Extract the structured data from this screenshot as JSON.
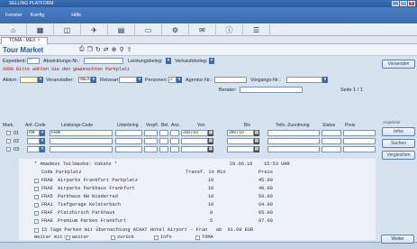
{
  "window": {
    "title": "SELLING PLATFORM"
  },
  "menu": [
    "Fenster",
    "Konfig",
    "Hilfe"
  ],
  "tab": {
    "label": "TOMA - MEX"
  },
  "page": {
    "title": "Tour Market"
  },
  "header": {
    "expedient_label": "Expedient:",
    "expedient_value": "**",
    "abwicklungs_label": "Abwicklungs-Nr.:",
    "leistungsbeleg_label": "Leistungsbeleg:",
    "verkaufsbeleg_label": "Verkaufsbeleg:",
    "error_msg": "X998 Bitte wählen Sie den gewünschten Parkplatz",
    "aktion_label": "Aktion:",
    "veranstalter_label": "Veranstalter:",
    "veranstalter_value": "MEX",
    "reiseart_label": "Reiseart:",
    "personen_label": "Personen:",
    "personen_value": "2",
    "agentur_label": "Agentur-Nr.:",
    "vorgangs_label": "Vorgangs-Nr.:",
    "berater_label": "Berater:",
    "seite_label": "Seite 1 / 1"
  },
  "grid": {
    "columns": [
      "Mark.",
      "Anf.-Code",
      "Leistungs-Code",
      "Unterbring.",
      "Verpfl.",
      "Bel.",
      "Anz.",
      "Von",
      "Bis",
      "Teiln.-Zuordnung",
      "Status",
      "Preis"
    ],
    "rows": [
      {
        "nr": "01",
        "code": "PA",
        "leistung": "FRA",
        "von": "200710",
        "bis": "280710"
      },
      {
        "nr": "02",
        "code": "",
        "leistung": "",
        "von": "",
        "bis": ""
      },
      {
        "nr": "03",
        "code": "",
        "leistung": "",
        "von": "",
        "bis": ""
      }
    ]
  },
  "result": {
    "heading": "* Amadeus Teilmaske: Vakanz *",
    "date": "29.06.10",
    "time": "15:53 UHR",
    "col_code": "Code Parkplatz",
    "col_transf": "Transf. in Min",
    "col_preis": "Preis",
    "items": [
      {
        "code": "FRA8",
        "name": "Airparks Frankfurt Parkplatz",
        "transf": "10",
        "preis": "45.00"
      },
      {
        "code": "FRA6",
        "name": "Airparks Parkhaus Frankfurt",
        "transf": "10",
        "preis": "49.00"
      },
      {
        "code": "FRA5",
        "name": "Parkhaus NH Niederrad",
        "transf": "10",
        "preis": "59.00"
      },
      {
        "code": "FRA1",
        "name": "Tiefgarage Kelsterbach",
        "transf": "10",
        "preis": "64.00"
      },
      {
        "code": "FRAF",
        "name": "Platzhirsch Parkhaus",
        "transf": "8",
        "preis": "65.00"
      },
      {
        "code": "FRA8",
        "name": "Premium Parken Frankfurt",
        "transf": "5",
        "preis": "87.00"
      }
    ],
    "extra": "15 Tage Parken mit Übernachtung ACHAT Hotel Airport - Fran   ab  91.00 EUR",
    "weiter_label": "Weiter mit:",
    "weiter_opts": [
      "weiter",
      "zurück",
      "Info",
      "TOMA"
    ]
  },
  "sidebar": {
    "versenden": "Versenden",
    "angebote_label": "Angebote",
    "infos": "Infos",
    "suchen": "Suchen",
    "vergleichen": "Vergleichen",
    "weiter": "Weiter"
  }
}
